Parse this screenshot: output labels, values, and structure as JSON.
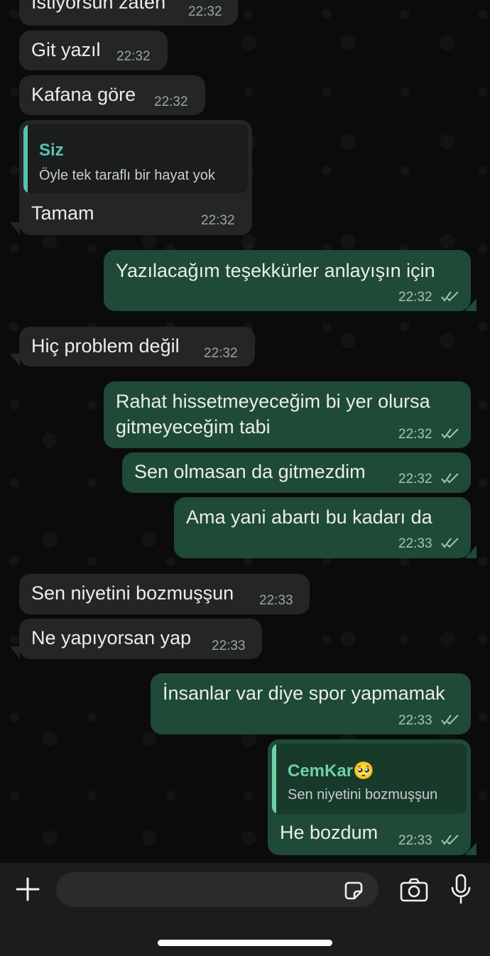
{
  "messages": [
    {
      "dir": "in",
      "text": "İstiyorsun zaten",
      "time": "22:32"
    },
    {
      "dir": "in",
      "text": "Git yazıl",
      "time": "22:32"
    },
    {
      "dir": "in",
      "text": "Kafana göre",
      "time": "22:32"
    },
    {
      "dir": "in",
      "text": "Tamam",
      "time": "22:32",
      "quote": {
        "author": "Siz",
        "text": "Öyle tek taraflı bir hayat yok"
      }
    },
    {
      "dir": "out",
      "text": "Yazılacağım teşekkürler anlayışın için",
      "time": "22:32"
    },
    {
      "dir": "in",
      "text": "Hiç problem değil",
      "time": "22:32"
    },
    {
      "dir": "out",
      "text_line1": "Rahat hissetmeyeceğim bi yer olursa",
      "text_line2": "gitmeyeceğim tabi",
      "time": "22:32"
    },
    {
      "dir": "out",
      "text": "Sen olmasan da gitmezdim",
      "time": "22:32"
    },
    {
      "dir": "out",
      "text": "Ama yani abartı bu kadarı da",
      "time": "22:33"
    },
    {
      "dir": "in",
      "text": "Sen niyetini bozmuşşun",
      "time": "22:33"
    },
    {
      "dir": "in",
      "text": "Ne yapıyorsan yap",
      "time": "22:33"
    },
    {
      "dir": "out",
      "text": "İnsanlar var diye spor yapmamak",
      "time": "22:33"
    },
    {
      "dir": "out",
      "text": "He bozdum",
      "time": "22:33",
      "quote": {
        "author": "CemKar",
        "emoji": "🥺",
        "text": "Sen niyetini bozmuşşun"
      }
    }
  ],
  "colors": {
    "incoming_bubble": "#242626",
    "outgoing_bubble": "#1e4a37",
    "quote_in_accent": "#57c3b4",
    "quote_out_accent": "#6fd0a3",
    "read_ticks": "#a9c2b6"
  },
  "input_bar": {
    "icons": [
      "plus-icon",
      "sticker-icon",
      "camera-icon",
      "microphone-icon"
    ],
    "value": ""
  }
}
